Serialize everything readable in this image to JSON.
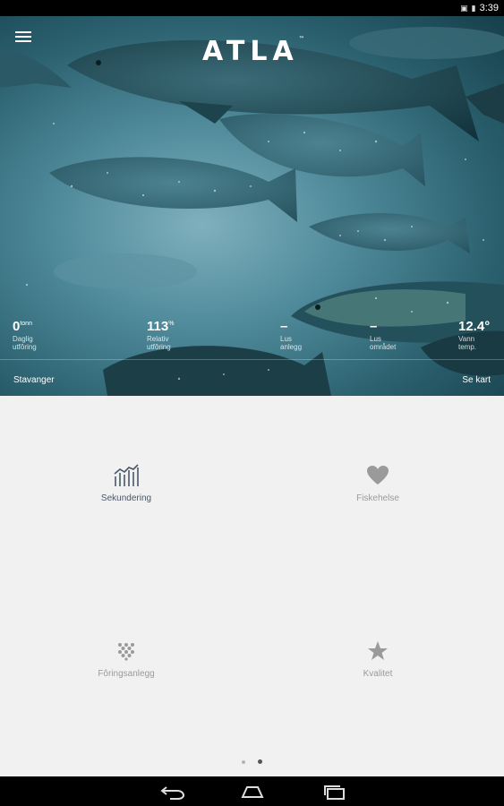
{
  "status_bar": {
    "time": "3:39",
    "icons": [
      "signal-icon",
      "battery-icon"
    ]
  },
  "hero": {
    "logo": "ATLA",
    "logo_mark": "™",
    "stats": [
      {
        "value": "0",
        "unit": "tonn",
        "label_line1": "Daglig",
        "label_line2": "utfôring"
      },
      {
        "value": "113",
        "unit": "%",
        "label_line1": "Relativ",
        "label_line2": "utfôring"
      },
      {
        "value": "–",
        "unit": "",
        "label_line1": "Lus",
        "label_line2": "anlegg"
      },
      {
        "value": "–",
        "unit": "",
        "label_line1": "Lus",
        "label_line2": "området"
      },
      {
        "value": "12.4°",
        "unit": "",
        "label_line1": "Vann",
        "label_line2": "temp."
      }
    ],
    "location": "Stavanger",
    "map_link": "Se kart"
  },
  "tiles": [
    {
      "label": "Sekundering",
      "icon": "chart-icon",
      "active": true
    },
    {
      "label": "Fiskehelse",
      "icon": "heart-icon",
      "active": false
    },
    {
      "label": "Fôringsanlegg",
      "icon": "pellets-icon",
      "active": false
    },
    {
      "label": "Kvalitet",
      "icon": "star-icon",
      "active": false
    }
  ],
  "pager": {
    "pages": 2,
    "current": 2
  },
  "nav_bar": {
    "buttons": [
      "back-icon",
      "home-icon",
      "recents-icon"
    ]
  },
  "colors": {
    "background": "#f1f1f1",
    "active_icon": "#4a5768",
    "inactive_icon": "#9a9a9a",
    "hero_water": "#4f8a9a"
  }
}
